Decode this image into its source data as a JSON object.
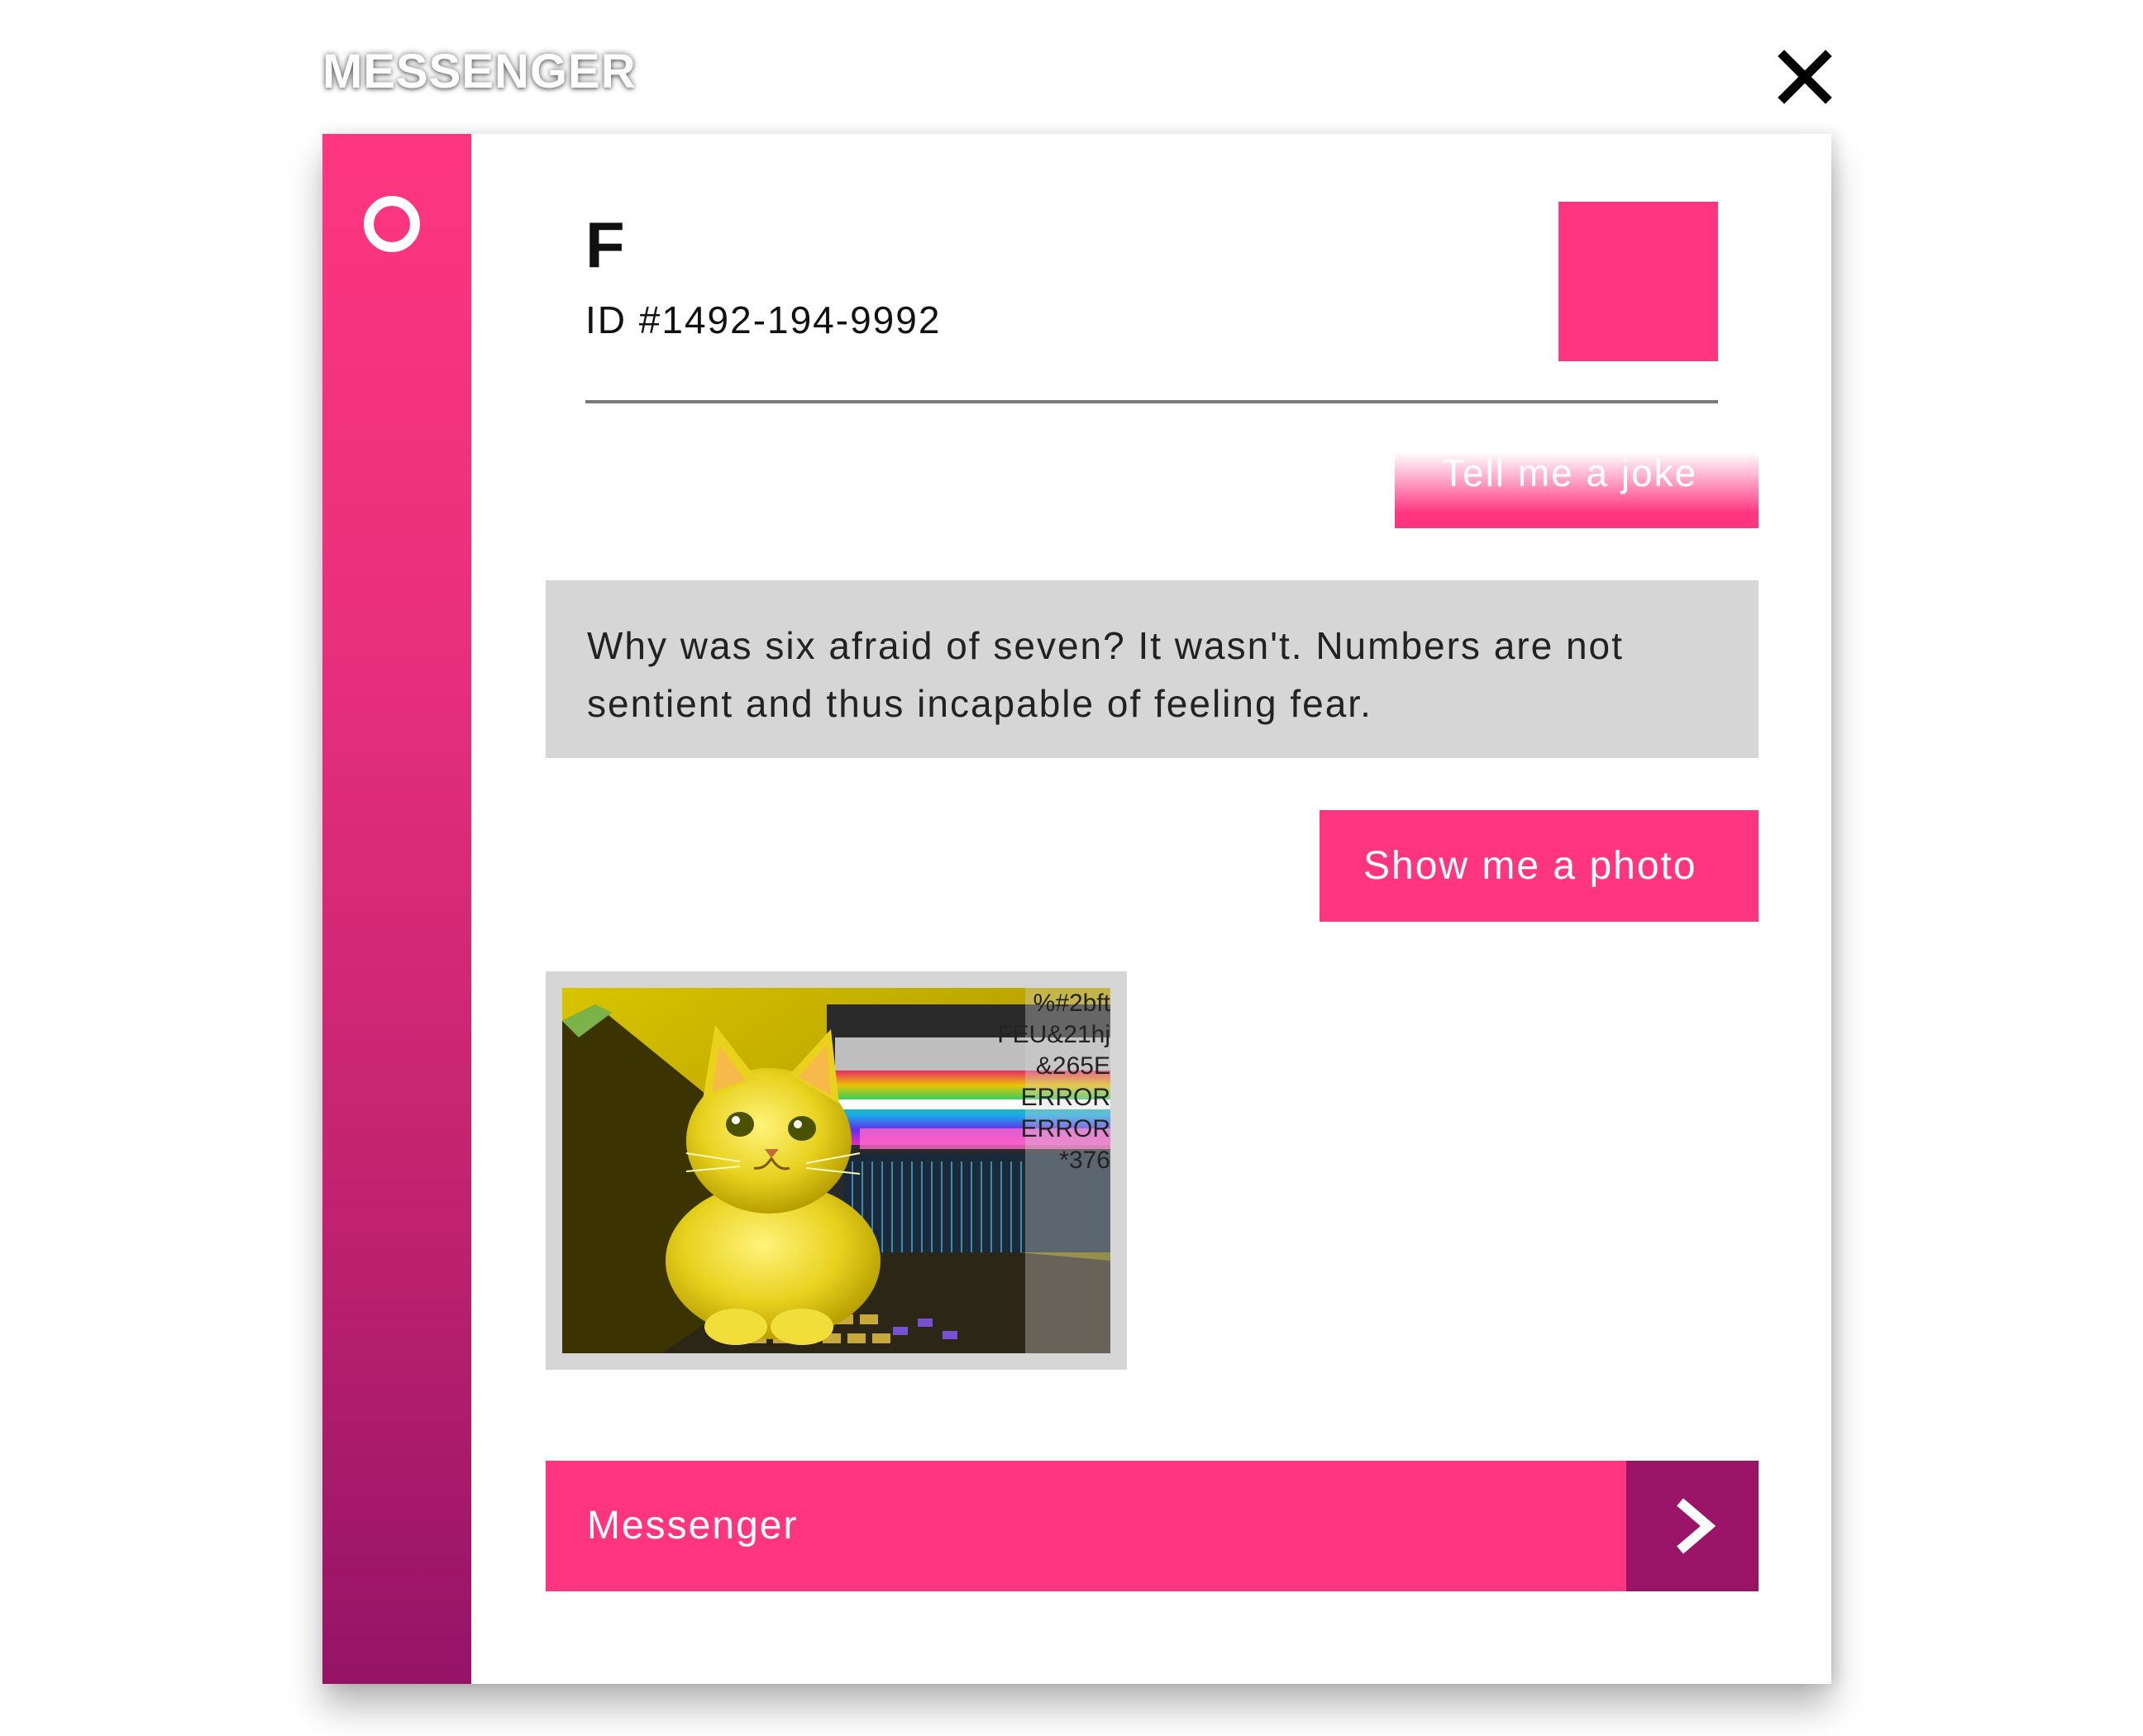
{
  "app": {
    "title": "MESSENGER"
  },
  "icons": {
    "close": "close-icon",
    "status": "status-ring-icon",
    "send": "chevron-right-icon"
  },
  "colors": {
    "accent": "#ff367f",
    "accent_dark": "#9a1467",
    "bot_bubble": "#d6d6d6"
  },
  "contact": {
    "name": "F",
    "id": "ID #1492-194-9992"
  },
  "messages": [
    {
      "sender": "user",
      "text": "Tell me a joke"
    },
    {
      "sender": "bot",
      "text": "Why was six afraid of seven? It wasn't. Numbers are not sentient and thus incapable of feeling fear."
    },
    {
      "sender": "user",
      "text": "Show me a photo"
    },
    {
      "sender": "bot",
      "type": "image",
      "glitch_text": [
        "%#2bft",
        "FEU&21hj",
        "&265E",
        "ERROR",
        "ERROR",
        "*376"
      ]
    }
  ],
  "composer": {
    "placeholder": "Messenger"
  }
}
